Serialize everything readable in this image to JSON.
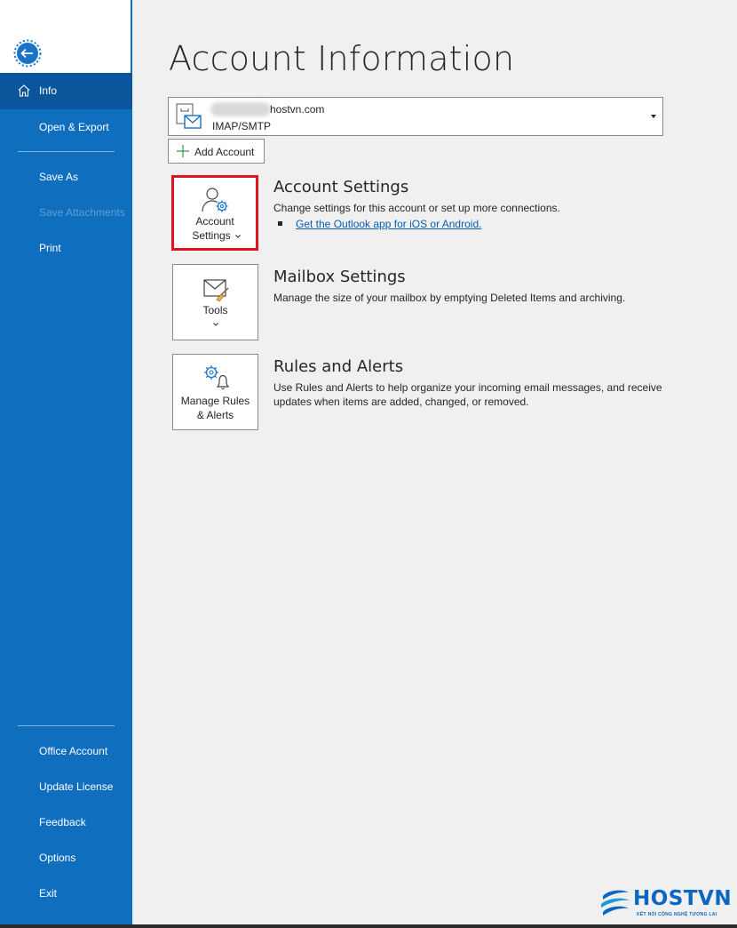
{
  "sidebar": {
    "active_item": "Info",
    "top_items": [
      "Open & Export"
    ],
    "middle_items": [
      "Save As",
      "Save Attachments",
      "Print"
    ],
    "bottom_items": [
      "Office Account",
      "Update License",
      "Feedback",
      "Options",
      "Exit"
    ]
  },
  "main": {
    "title": "Account Information",
    "account": {
      "email": "hostvn.com",
      "type": "IMAP/SMTP"
    },
    "add_account_label": "Add Account",
    "sections": [
      {
        "tile_label_line1": "Account",
        "tile_label_line2": "Settings",
        "title": "Account Settings",
        "description": "Change settings for this account or set up more connections.",
        "link": "Get the Outlook app for iOS or Android."
      },
      {
        "tile_label_line1": "Tools",
        "title": "Mailbox Settings",
        "description": "Manage the size of your mailbox by emptying Deleted Items and archiving."
      },
      {
        "tile_label_line1": "Manage Rules",
        "tile_label_line2": "& Alerts",
        "title": "Rules and Alerts",
        "description_line1": "Use Rules and Alerts to help organize your incoming email messages, and receive",
        "description_line2": "updates when items are added, changed, or removed."
      }
    ]
  },
  "watermark": {
    "brand": "HOSTVN",
    "tagline": "KẾT NỐI CÔNG NGHỆ TƯƠNG LAI"
  },
  "colors": {
    "sidebar": "#106ebe",
    "sidebar_active": "#0b559c",
    "highlight_border": "#e0141e",
    "link": "#0b5cad"
  },
  "icons": {
    "back": "back-arrow-icon",
    "info": "home-icon",
    "account": "mailbox-account-icon",
    "add": "plus-icon",
    "account_settings": "person-gear-icon",
    "tools": "envelope-broom-icon",
    "rules": "gear-bell-icon"
  }
}
